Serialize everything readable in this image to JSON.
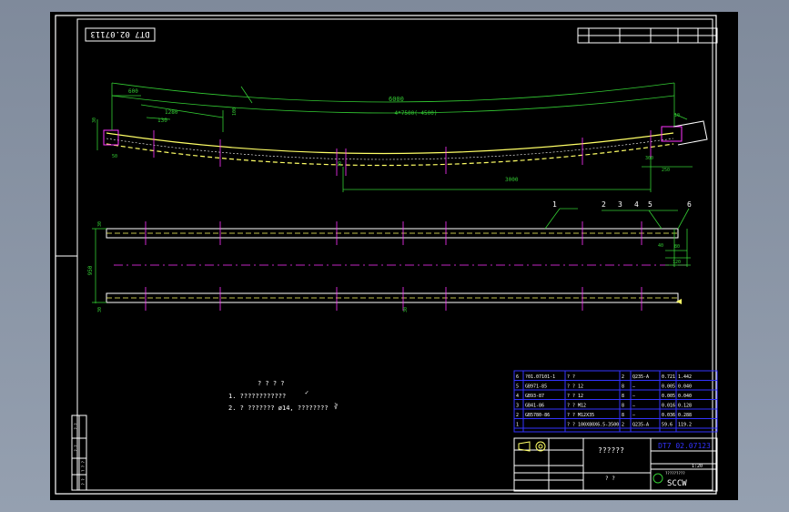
{
  "colors": {
    "frame": "#ffffff",
    "dim": "#33cc33",
    "spring": "#ffff66",
    "center": "#ff33ff",
    "table": "#3333ff",
    "text_white": "#ffffff",
    "text_yellow": "#ffff66"
  },
  "drawing": {
    "code_rotated": "DT7 02.07113",
    "dims_top": {
      "span": "6000",
      "chord_label": "4*7500(-4500)",
      "left": "600",
      "l1": "1280",
      "l2": "130",
      "l3": "100",
      "l4": "50",
      "right_a": "10",
      "right_b": "300",
      "right_c": "250",
      "bottom": "3000",
      "vert_a": "30",
      "vert_b": "10"
    },
    "plan_dims": {
      "width": "950",
      "left_top": "30",
      "left_bottom": "30",
      "mid_bottom": "30",
      "right_a": "80",
      "right_b": "40",
      "right_c": "120"
    },
    "callouts": [
      "1",
      "2",
      "3",
      "4",
      "5",
      "6"
    ]
  },
  "notes": {
    "title": "? ? ? ?",
    "line1": "1. ????????????",
    "line1_mark": "✓",
    "line2": "2. ? ??????? ø14, ????????",
    "line2_mark": "∛"
  },
  "parts_table": {
    "rows": [
      {
        "no": "6",
        "code": "?01.07101-1",
        "name": "? ?",
        "qty": "2",
        "material": "Q235-A",
        "w1": "0.721",
        "w2": "1.442"
      },
      {
        "no": "5",
        "code": "GB971-85",
        "name": "? ? 12",
        "qty": "8",
        "material": "—",
        "w1": "0.005",
        "w2": "0.040"
      },
      {
        "no": "4",
        "code": "GB93-87",
        "name": "? ? 12",
        "qty": "8",
        "material": "—",
        "w1": "0.005",
        "w2": "0.040"
      },
      {
        "no": "3",
        "code": "GB41-86",
        "name": "? ? M12",
        "qty": "8",
        "material": "—",
        "w1": "0.016",
        "w2": "0.128"
      },
      {
        "no": "2",
        "code": "GB5780-86",
        "name": "? ? M12X35",
        "qty": "8",
        "material": "—",
        "w1": "0.036",
        "w2": "0.288"
      },
      {
        "no": "1",
        "code": "",
        "name": "? ? 100X80X6.5-3500",
        "qty": "2",
        "material": "Q235-A",
        "w1": "59.6",
        "w2": "119.2"
      }
    ]
  },
  "title_block": {
    "drawing_no": "DT7 02.07123",
    "title": "??????",
    "scale": "1:20",
    "company": "SCCW",
    "company_sub": "?????????",
    "footer": "? ?"
  },
  "left_strip": [
    "? ?",
    "? ?",
    "? ? ?",
    "? ?"
  ]
}
